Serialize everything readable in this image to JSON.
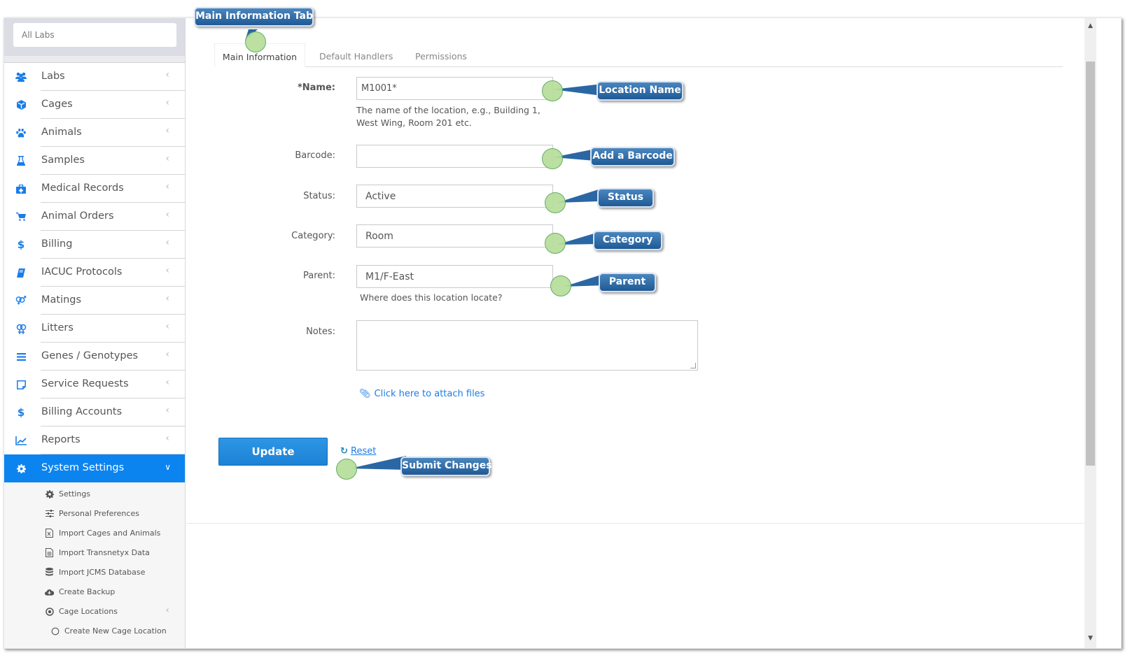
{
  "sidebar": {
    "lab_select": "All Labs",
    "items": [
      {
        "label": "Labs",
        "icon": "users-icon"
      },
      {
        "label": "Cages",
        "icon": "cube-icon"
      },
      {
        "label": "Animals",
        "icon": "paw-icon"
      },
      {
        "label": "Samples",
        "icon": "flask-icon"
      },
      {
        "label": "Medical Records",
        "icon": "medkit-icon"
      },
      {
        "label": "Animal Orders",
        "icon": "cart-icon"
      },
      {
        "label": "Billing",
        "icon": "dollar-icon"
      },
      {
        "label": "IACUC Protocols",
        "icon": "book-icon"
      },
      {
        "label": "Matings",
        "icon": "venus-mars-icon"
      },
      {
        "label": "Litters",
        "icon": "venus-double-icon"
      },
      {
        "label": "Genes / Genotypes",
        "icon": "bars-icon"
      },
      {
        "label": "Service Requests",
        "icon": "note-icon"
      },
      {
        "label": "Billing Accounts",
        "icon": "dollar-icon"
      },
      {
        "label": "Reports",
        "icon": "line-chart-icon"
      },
      {
        "label": "System Settings",
        "icon": "gear-icon"
      }
    ],
    "sub_items": [
      {
        "label": "Settings",
        "icon": "gear-icon"
      },
      {
        "label": "Personal Preferences",
        "icon": "sliders-icon"
      },
      {
        "label": "Import Cages and Animals",
        "icon": "excel-file-icon"
      },
      {
        "label": "Import Transnetyx Data",
        "icon": "text-file-icon"
      },
      {
        "label": "Import JCMS Database",
        "icon": "database-icon"
      },
      {
        "label": "Create Backup",
        "icon": "cloud-download-icon"
      },
      {
        "label": "Cage Locations",
        "icon": "dot-circle-icon"
      },
      {
        "label": "Create New Cage Location",
        "icon": "circle-icon"
      }
    ]
  },
  "tabs": [
    {
      "label": "Main Information",
      "active": true
    },
    {
      "label": "Default Handlers",
      "active": false
    },
    {
      "label": "Permissions",
      "active": false
    }
  ],
  "form": {
    "name": {
      "label": "*Name:",
      "value": "M1001*",
      "help": "The name of the location, e.g., Building 1, West Wing, Room 201 etc."
    },
    "barcode": {
      "label": "Barcode:",
      "value": ""
    },
    "status": {
      "label": "Status:",
      "value": "Active"
    },
    "category": {
      "label": "Category:",
      "value": "Room"
    },
    "parent": {
      "label": "Parent:",
      "value": "M1/F-East",
      "help": "Where does this location locate?"
    },
    "notes": {
      "label": "Notes:",
      "value": ""
    },
    "attach_label": "Click here to attach files",
    "update_label": "Update",
    "reset_label": "Reset"
  },
  "annotations": {
    "main_tab": "Main Information Tab",
    "location_name": "Location Name",
    "barcode": "Add a Barcode",
    "status": "Status",
    "category": "Category",
    "parent": "Parent",
    "submit": "Submit Changes"
  },
  "colors": {
    "accent": "#0c84f0",
    "link": "#1a7de8",
    "callout": "#2a67a4",
    "marker": "#b6de9b"
  }
}
